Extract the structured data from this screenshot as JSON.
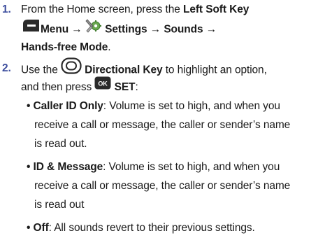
{
  "step1": {
    "number": "1.",
    "text_a": "From the Home screen, press the ",
    "bold_a": "Left Soft Key",
    "bold_b": "Menu",
    "arrow1": " → ",
    "bold_c": "Settings",
    "arrow2": " → ",
    "bold_d": "Sounds",
    "arrow3": " →",
    "bold_e": "Hands-free Mode",
    "end": "."
  },
  "step2": {
    "number": "2.",
    "text_a": "Use the ",
    "bold_a": "Directional Key",
    "text_b": " to highlight an option,",
    "text_c": "and then press ",
    "ok_label": "OK",
    "bold_b": "SET",
    "text_d": ":"
  },
  "options": [
    {
      "name": "Caller ID Only",
      "line1": ": Volume is set to high, and when you",
      "line2": "receive a call or message, the caller or sender’s name",
      "line3": "is read out."
    },
    {
      "name": "ID & Message",
      "line1": ": Volume is set to high, and when you",
      "line2": "receive a call or message, the caller or sender’s name",
      "line3": "is read out"
    },
    {
      "name": "Off",
      "line1": ": All sounds revert to their previous settings."
    }
  ],
  "icons": {
    "soft_key": "left-soft-key-icon",
    "settings": "settings-icon",
    "directional": "directional-key-icon",
    "ok": "ok-key-icon"
  },
  "colors": {
    "number": "#3d4e9e",
    "text": "#1a1a1a",
    "key": "#2a2a2a",
    "settings_green": "#6aa84f"
  }
}
